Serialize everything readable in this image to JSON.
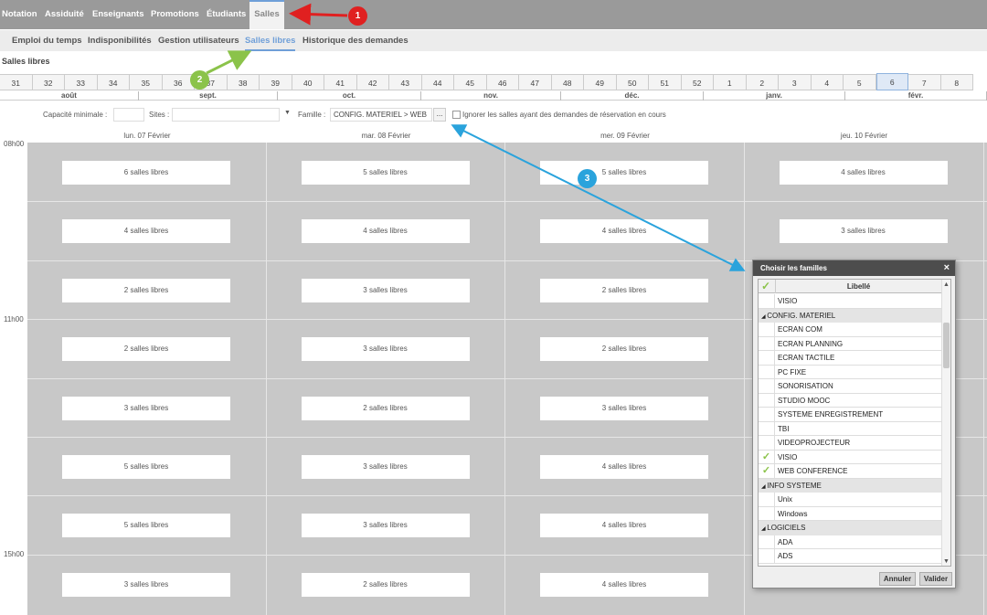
{
  "topnav": [
    "Notation",
    "Assiduité",
    "Enseignants",
    "Promotions",
    "Étudiants",
    "Salles"
  ],
  "subnav": [
    "Emploi du temps",
    "Indisponibilités",
    "Gestion utilisateurs",
    "Salles libres",
    "Historique des demandes"
  ],
  "page_title": "Salles libres",
  "weeks": [
    "31",
    "32",
    "33",
    "34",
    "35",
    "36",
    "37",
    "38",
    "39",
    "40",
    "41",
    "42",
    "43",
    "44",
    "45",
    "46",
    "47",
    "48",
    "49",
    "50",
    "51",
    "52",
    "1",
    "2",
    "3",
    "4",
    "5",
    "6",
    "7",
    "8"
  ],
  "active_week": "6",
  "months": [
    "août",
    "sept.",
    "oct.",
    "nov.",
    "déc.",
    "janv.",
    "févr."
  ],
  "filters": {
    "capacity_label": "Capacité minimale :",
    "sites_label": "Sites :",
    "family_label": "Famille :",
    "family_value": "CONFIG. MATERIEL > WEB",
    "browse_button": "...",
    "ignore_label": "Ignorer les salles ayant des demandes de réservation en cours"
  },
  "days": [
    "lun. 07 Février",
    "mar. 08 Février",
    "mer. 09 Février",
    "jeu. 10 Février"
  ],
  "times": [
    "08h00",
    "11h00",
    "15h00"
  ],
  "slots": [
    [
      "6 salles libres",
      "5 salles libres",
      "5 salles libres",
      "4 salles libres"
    ],
    [
      "4 salles libres",
      "4 salles libres",
      "4 salles libres",
      "3 salles libres"
    ],
    [
      "2 salles libres",
      "3 salles libres",
      "2 salles libres",
      ""
    ],
    [
      "2 salles libres",
      "3 salles libres",
      "2 salles libres",
      ""
    ],
    [
      "3 salles libres",
      "2 salles libres",
      "3 salles libres",
      ""
    ],
    [
      "5 salles libres",
      "3 salles libres",
      "4 salles libres",
      ""
    ],
    [
      "5 salles libres",
      "3 salles libres",
      "4 salles libres",
      ""
    ],
    [
      "3 salles libres",
      "2 salles libres",
      "4 salles libres",
      ""
    ]
  ],
  "dialog": {
    "title": "Choisir les familles",
    "close": "×",
    "column_header": "Libellé",
    "rows": [
      {
        "type": "item",
        "label": "VISIO",
        "checked": false
      },
      {
        "type": "group",
        "label": "CONFIG. MATERIEL"
      },
      {
        "type": "item",
        "label": "ECRAN COM",
        "checked": false
      },
      {
        "type": "item",
        "label": "ECRAN PLANNING",
        "checked": false
      },
      {
        "type": "item",
        "label": "ECRAN TACTILE",
        "checked": false
      },
      {
        "type": "item",
        "label": "PC FIXE",
        "checked": false
      },
      {
        "type": "item",
        "label": "SONORISATION",
        "checked": false
      },
      {
        "type": "item",
        "label": "STUDIO MOOC",
        "checked": false
      },
      {
        "type": "item",
        "label": "SYSTEME ENREGISTREMENT",
        "checked": false
      },
      {
        "type": "item",
        "label": "TBI",
        "checked": false
      },
      {
        "type": "item",
        "label": "VIDEOPROJECTEUR",
        "checked": false
      },
      {
        "type": "item",
        "label": "VISIO",
        "checked": true
      },
      {
        "type": "item",
        "label": "WEB CONFERENCE",
        "checked": true
      },
      {
        "type": "group",
        "label": "INFO SYSTEME"
      },
      {
        "type": "item",
        "label": "Unix",
        "checked": false
      },
      {
        "type": "item",
        "label": "Windows",
        "checked": false
      },
      {
        "type": "group",
        "label": "LOGICIELS"
      },
      {
        "type": "item",
        "label": "ADA",
        "checked": false
      },
      {
        "type": "item",
        "label": "ADS",
        "checked": false
      }
    ],
    "cancel_button": "Annuler",
    "validate_button": "Valider"
  },
  "annotations": [
    "1",
    "2",
    "3"
  ],
  "colors": {
    "accent": "#6f9fd8",
    "red": "#e02020",
    "green": "#8bc34a",
    "blue": "#2aa3dc"
  }
}
